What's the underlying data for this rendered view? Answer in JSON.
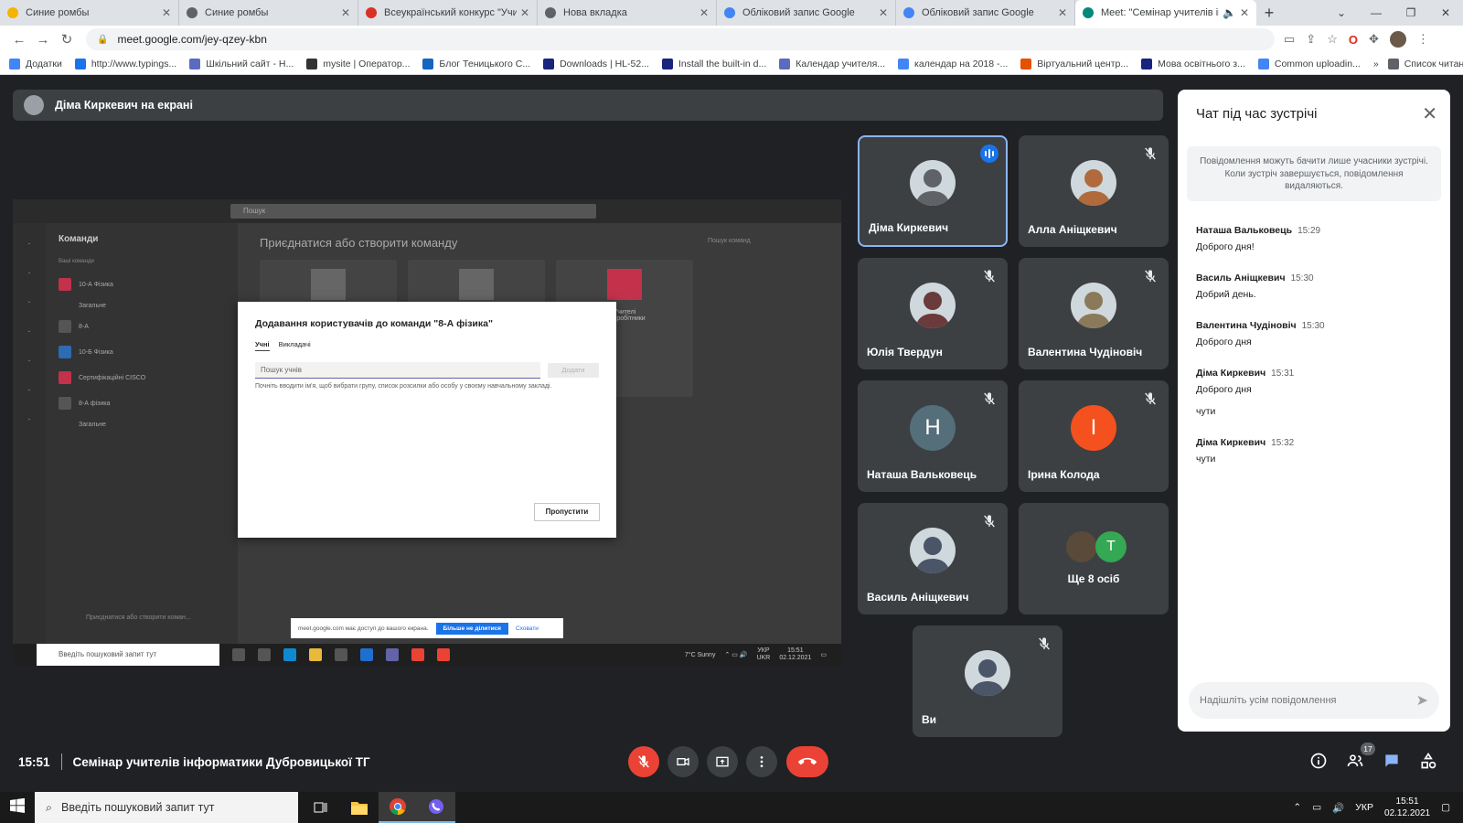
{
  "browser": {
    "tabs": [
      {
        "title": "Синие ромбы",
        "icon": "chart-icon",
        "color": "#f4b400"
      },
      {
        "title": "Синие ромбы",
        "icon": "globe-icon",
        "color": "#5f6368"
      },
      {
        "title": "Всеукраїнський конкурс \"Учите",
        "icon": "flame-icon",
        "color": "#d93025"
      },
      {
        "title": "Нова вкладка",
        "icon": "chrome-icon",
        "color": "#5f6368"
      },
      {
        "title": "Обліковий запис Google",
        "icon": "google-icon",
        "color": "#4285f4"
      },
      {
        "title": "Обліковий запис Google",
        "icon": "google-icon",
        "color": "#4285f4"
      },
      {
        "title": "Meet: \"Семінар учителів ін",
        "icon": "meet-icon",
        "color": "#00897b"
      }
    ],
    "url": "meet.google.com/jey-qzey-kbn",
    "bookmarks": [
      "Додатки",
      "http://www.typings...",
      "Шкільний сайт - Н...",
      "mysite | Оператор...",
      "Блог Теницького С...",
      "Downloads | HL-52...",
      "Install the built-in d...",
      "Календар учителя...",
      "календар на 2018 -...",
      "Віртуальний центр...",
      "Мова освітнього з...",
      "Common uploadin..."
    ],
    "reading_list": "Список читання"
  },
  "presenter_bar": {
    "label": "Діма Киркевич на екрані"
  },
  "shared_screen": {
    "search_placeholder": "Пошук",
    "sidebar_title": "Команди",
    "your_teams": "Ваші команди",
    "teams": [
      {
        "name": "10-А Фізика",
        "sub": "Загальне",
        "color": "#c4314b"
      },
      {
        "name": "8-А",
        "sub": "",
        "color": "#555"
      },
      {
        "name": "10-Б Фізика",
        "sub": "",
        "color": "#2d6bb5"
      },
      {
        "name": "Сертифікаційні CISCO",
        "sub": "",
        "color": "#c4314b"
      },
      {
        "name": "8-А фізика",
        "sub": "Загальне",
        "color": "#555"
      }
    ],
    "main_heading": "Приєднатися або створити команду",
    "team_search": "Пошук команд",
    "card_label": "Учителі",
    "card_sub": "Співробітники",
    "join_create": "Приєднатися або створити коман...",
    "dialog": {
      "title": "Додавання користувачів до команди \"8-А фізика\"",
      "tab_students": "Учні",
      "tab_teachers": "Викладачі",
      "input_placeholder": "Пошук учнів",
      "add_label": "Додати",
      "hint": "Почніть вводити ім'я, щоб вибрати групу, список розсилки або особу у своєму навчальному закладі.",
      "skip_label": "Пропустити"
    },
    "share_notice": {
      "text": "meet.google.com має доступ до вашого екрана.",
      "stop": "Більше не ділитися",
      "hide": "Сховати"
    },
    "taskbar_search": "Введіть пошуковий запит тут",
    "weather": "7°C  Sunny",
    "lang": "УКР",
    "lang2": "UKR",
    "time": "15:51",
    "date": "02.12.2021"
  },
  "participants": [
    {
      "name": "Діма Киркевич",
      "speaking": true,
      "avatar_color": "#5f6368"
    },
    {
      "name": "Алла Аніщкевич",
      "muted": true,
      "avatar_color": "#b06a3b"
    },
    {
      "name": "Юлія Твердун",
      "muted": true,
      "avatar_color": "#6b3a3a"
    },
    {
      "name": "Валентина Чудіновіч",
      "muted": true,
      "avatar_color": "#8a7a5a"
    },
    {
      "name": "Наташа Вальковець",
      "muted": true,
      "initial": "Н",
      "avatar_color": "#546e7a"
    },
    {
      "name": "Ірина Колода",
      "muted": true,
      "initial": "І",
      "avatar_color": "#f4511e"
    },
    {
      "name": "Василь Аніщкевич",
      "muted": true,
      "avatar_color": "#4a5568"
    },
    {
      "name": "Ще 8 осіб",
      "more": true,
      "initial": "T"
    },
    {
      "name": "Ви",
      "muted": true,
      "avatar_color": "#4a5568"
    }
  ],
  "chat": {
    "title": "Чат під час зустрічі",
    "notice": "Повідомлення можуть бачити лише учасники зустрічі. Коли зустріч завершується, повідомлення видаляються.",
    "messages": [
      {
        "sender": "Наташа Вальковець",
        "time": "15:29",
        "text": "Доброго дня!",
        "text2": ""
      },
      {
        "sender": "Василь Аніщкевич",
        "time": "15:30",
        "text": "Добрий день.",
        "text2": ""
      },
      {
        "sender": "Валентина Чудіновіч",
        "time": "15:30",
        "text": "Доброго дня",
        "text2": ""
      },
      {
        "sender": "Діма Киркевич",
        "time": "15:31",
        "text": "Доброго дня",
        "text2": "чути"
      },
      {
        "sender": "Діма Киркевич",
        "time": "15:32",
        "text": "чути",
        "text2": ""
      }
    ],
    "input_placeholder": "Надішліть усім повідомлення"
  },
  "meeting": {
    "time": "15:51",
    "title": "Семінар учителів інформатики Дубровицької ТГ",
    "participant_count": "17"
  },
  "os_taskbar": {
    "search_placeholder": "Введіть пошуковий запит тут",
    "lang": "УКР",
    "time": "15:51",
    "date": "02.12.2021"
  }
}
